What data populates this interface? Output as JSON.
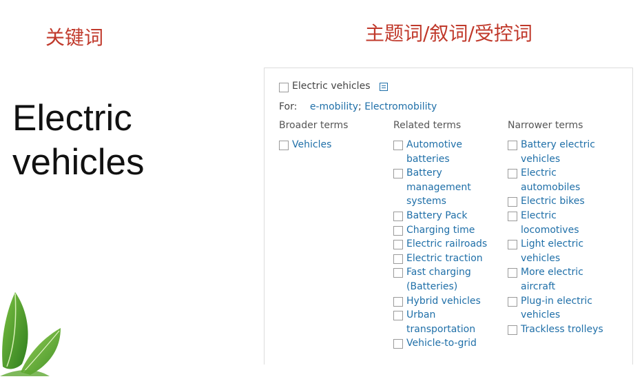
{
  "headings": {
    "keyword": "关键词",
    "subject": "主题词/叙词/受控词"
  },
  "big_title": [
    "Electric",
    "vehicles"
  ],
  "panel": {
    "main_term": "Electric vehicles",
    "for_label": "For:",
    "for_terms": [
      "e-mobility",
      "Electromobility"
    ],
    "columns": [
      {
        "header": "Broader terms",
        "items": [
          "Vehicles"
        ]
      },
      {
        "header": "Related terms",
        "items": [
          "Automotive batteries",
          "Battery management systems",
          "Battery Pack",
          "Charging time",
          "Electric railroads",
          "Electric traction",
          "Fast charging (Batteries)",
          "Hybrid vehicles",
          "Urban transportation",
          "Vehicle-to-grid"
        ]
      },
      {
        "header": "Narrower terms",
        "items": [
          "Battery electric vehicles",
          "Electric automobiles",
          "Electric bikes",
          "Electric locomotives",
          "Light electric vehicles",
          "More electric aircraft",
          "Plug-in electric vehicles",
          "Trackless trolleys"
        ]
      }
    ]
  },
  "colors": {
    "heading_red": "#c0392b",
    "link_blue": "#1f6fa8",
    "leaf_green": "#4f9a2a"
  },
  "icons": [
    "detail-icon",
    "leaf-decoration"
  ]
}
